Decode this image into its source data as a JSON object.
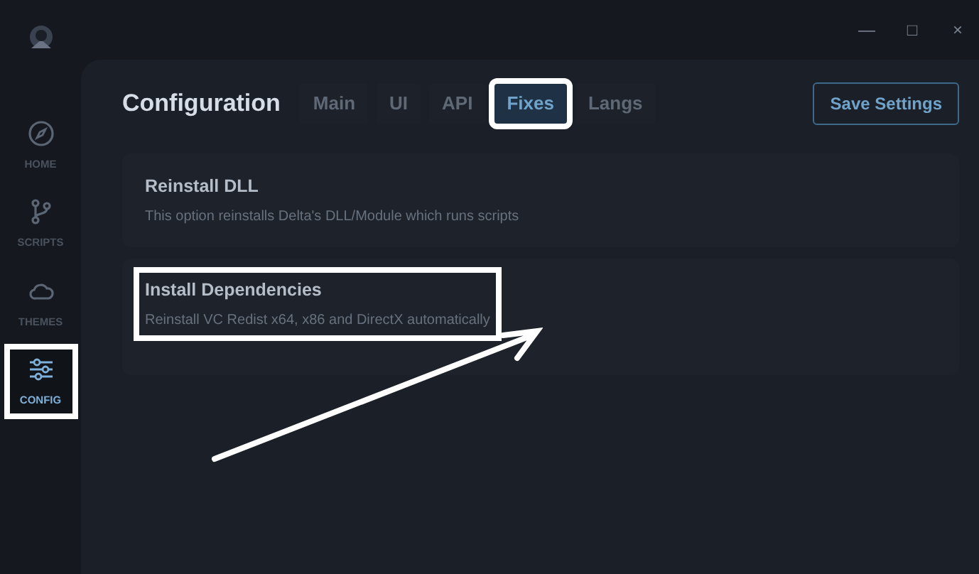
{
  "window": {
    "controls": [
      "—",
      "□",
      "×"
    ]
  },
  "sidebar": {
    "items": [
      {
        "kind": "compass",
        "label": "HOME",
        "selected": false,
        "highlighted": false
      },
      {
        "kind": "branch",
        "label": "SCRIPTS",
        "selected": false,
        "highlighted": false
      },
      {
        "kind": "cloud",
        "label": "THEMES",
        "selected": false,
        "highlighted": false
      },
      {
        "kind": "sliders",
        "label": "CONFIG",
        "selected": true,
        "highlighted": true
      }
    ]
  },
  "header": {
    "title": "Configuration",
    "save_button": "Save Settings"
  },
  "tabs": [
    {
      "label": "Main",
      "selected": false,
      "highlighted": false
    },
    {
      "label": "UI",
      "selected": false,
      "highlighted": false
    },
    {
      "label": "API",
      "selected": false,
      "highlighted": false
    },
    {
      "label": "Fixes",
      "selected": true,
      "highlighted": true
    },
    {
      "label": "Langs",
      "selected": false,
      "highlighted": false
    }
  ],
  "options": [
    {
      "title": "Reinstall DLL",
      "description": "This option reinstalls Delta's DLL/Module which runs scripts",
      "highlighted": false
    },
    {
      "title": "Install Dependencies",
      "description": "Reinstall VC Redist x64, x86 and DirectX automatically",
      "highlighted": true
    }
  ]
}
